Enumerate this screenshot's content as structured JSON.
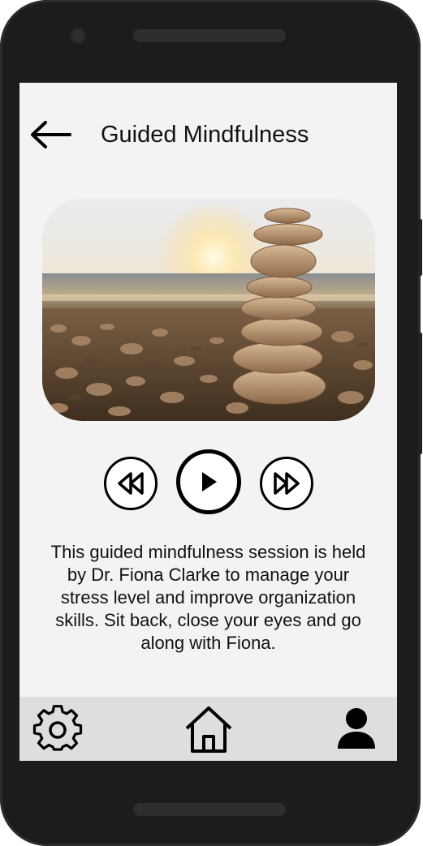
{
  "header": {
    "title": "Guided Mindfulness",
    "back_icon": "arrow-left-icon"
  },
  "hero": {
    "image": "stacked-pebbles-beach-sunset"
  },
  "player": {
    "rewind_icon": "rewind-icon",
    "play_icon": "play-icon",
    "forward_icon": "fast-forward-icon"
  },
  "description": {
    "lines": [
      "This guided mindfulness session is held",
      "by Dr. Fiona Clarke to manage your",
      "stress level and improve organization",
      "skills. Sit back, close your eyes and go",
      "along with Fiona."
    ]
  },
  "bottom_nav": {
    "items": [
      {
        "name": "settings",
        "icon": "gear-icon"
      },
      {
        "name": "home",
        "icon": "home-icon"
      },
      {
        "name": "profile",
        "icon": "user-icon"
      }
    ]
  },
  "colors": {
    "screen_bg": "#f3f3f3",
    "nav_bg": "#dedede",
    "phone_body": "#1c1c1c",
    "icon": "#000000"
  }
}
